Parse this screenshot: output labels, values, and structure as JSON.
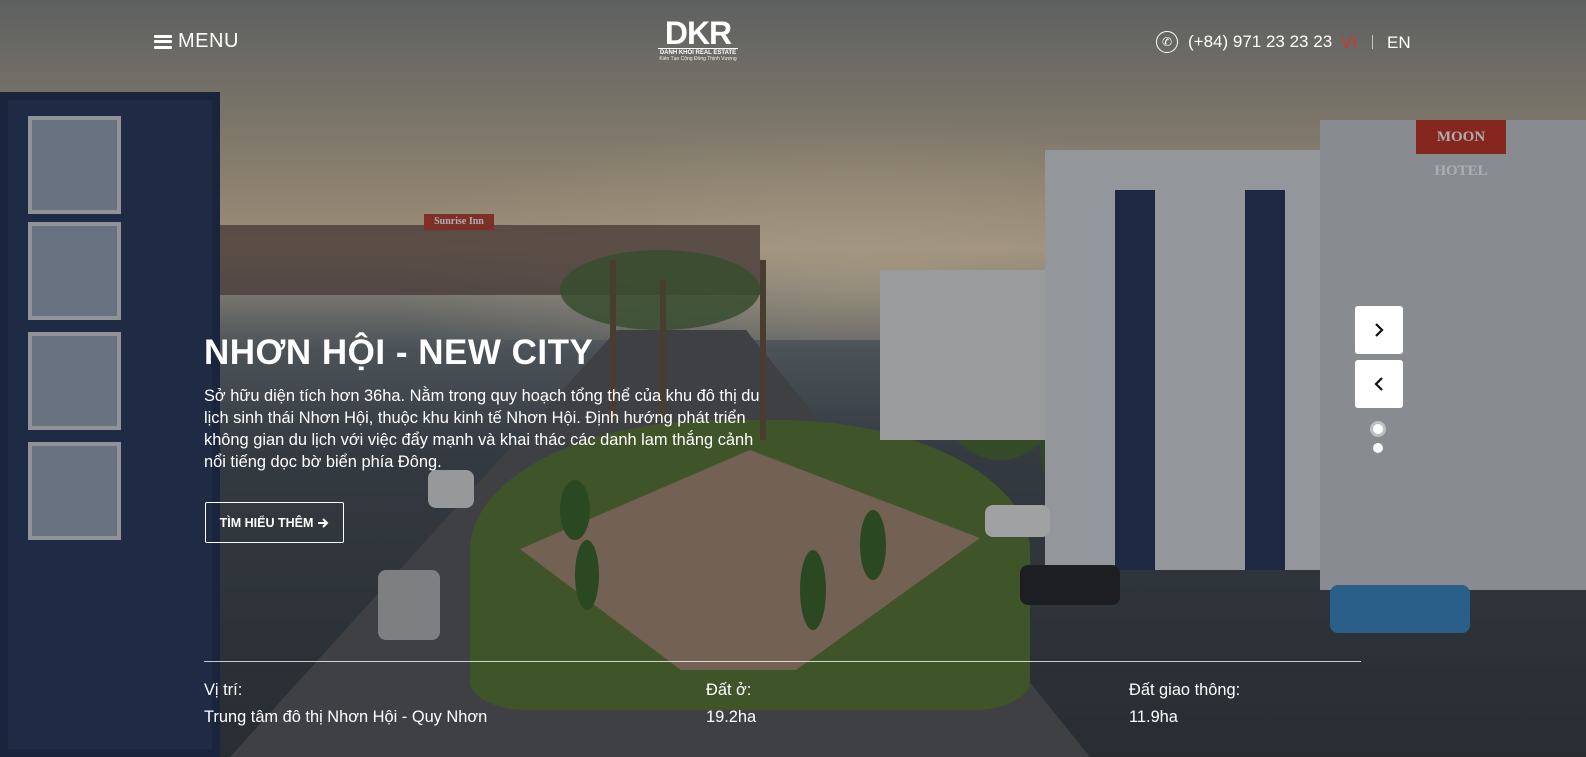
{
  "header": {
    "menu_label": "MENU",
    "logo": {
      "mark": "DKR",
      "subtitle": "DANH KHOI REAL ESTATE",
      "tagline": "Kiến Tạo Cộng Đồng Thịnh Vượng"
    },
    "phone": "(+84) 971 23 23 23",
    "languages": [
      "VI",
      "EN"
    ],
    "active_language": "VI"
  },
  "hero": {
    "title": "NHƠN HỘI - NEW CITY",
    "description": "Sở hữu diện tích hơn 36ha. Nằm trong quy hoạch tổng thể của khu đô thị du lịch sinh thái Nhơn Hội, thuộc khu kinh tế Nhơn Hội. Định hướng phát triển không gian du lịch với việc đẩy mạnh và khai thác các danh lam thắng cảnh nổi tiếng dọc bờ biển phía Đông.",
    "cta_label": "TÌM HIỂU THÊM"
  },
  "slider": {
    "slide_count": 2,
    "active_index": 0
  },
  "info": [
    {
      "label": "Vị trí:",
      "value": "Trung tâm đô thị Nhơn Hội - Quy Nhơn"
    },
    {
      "label": "Đất ở:",
      "value": "19.2ha"
    },
    {
      "label": "Đất giao thông:",
      "value": "11.9ha"
    }
  ],
  "scene": {
    "hotel_sign": "MOON HOTEL",
    "far_sign": "Sunrise Inn"
  },
  "colors": {
    "active_language": "#d6352b",
    "overlay": "rgba(0,0,0,0.32)"
  },
  "icons": {
    "menu": "hamburger-icon",
    "phone": "phone-icon",
    "next": "chevron-right-icon",
    "prev": "chevron-left-icon",
    "cta": "arrow-right-icon"
  }
}
